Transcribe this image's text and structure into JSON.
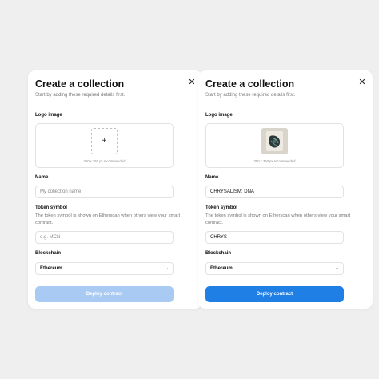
{
  "colors": {
    "background": "#efefef",
    "card": "#ffffff",
    "primary": "#1f7fe5",
    "primary_disabled": "#a9cbf3"
  },
  "empty_form": {
    "title": "Create a collection",
    "subtitle": "Start by adding these required details first.",
    "close_icon": "close-icon",
    "logo_label": "Logo image",
    "upload_icon": "plus-icon",
    "recommendation": "350 x 350 px recommended",
    "name_label": "Name",
    "name_placeholder": "My collection name",
    "symbol_label": "Token symbol",
    "symbol_help": "The token symbol is shown on Etherscan when others view your smart contract.",
    "symbol_placeholder": "e.g. MCN",
    "blockchain_label": "Blockchain",
    "blockchain_value": "Ethereum",
    "button_label": "Deploy contract",
    "button_state": "disabled"
  },
  "filled_form": {
    "title": "Create a collection",
    "subtitle": "Start by adding these required details first.",
    "close_icon": "close-icon",
    "logo_label": "Logo image",
    "recommendation": "350 x 350 px recommended",
    "name_label": "Name",
    "name_value": "CHRYSALISM: DNA",
    "symbol_label": "Token symbol",
    "symbol_help": "The token symbol is shown on Etherscan when others view your smart contract.",
    "symbol_value": "CHRYS",
    "blockchain_label": "Blockchain",
    "blockchain_value": "Ethereum",
    "button_label": "Deploy contract",
    "button_state": "enabled"
  }
}
